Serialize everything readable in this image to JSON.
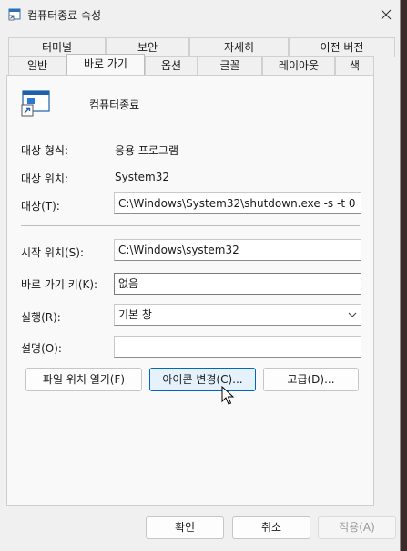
{
  "window": {
    "title": "컴퓨터종료 속성"
  },
  "tabs": {
    "row1": [
      "터미널",
      "보안",
      "자세히",
      "이전 버전"
    ],
    "row2": [
      "일반",
      "바로 가기",
      "옵션",
      "글꼴",
      "레이아웃",
      "색"
    ]
  },
  "shortcut": {
    "name": "컴퓨터종료",
    "target_type_label": "대상 형식:",
    "target_type": "응용 프로그램",
    "target_location_label": "대상 위치:",
    "target_location": "System32",
    "target_label": "대상(T):",
    "target": "C:\\Windows\\System32\\shutdown.exe -s -t 0",
    "start_in_label": "시작 위치(S):",
    "start_in": "C:\\Windows\\system32",
    "hotkey_label": "바로 가기 키(K):",
    "hotkey": "없음",
    "run_label": "실행(R):",
    "run": "기본 창",
    "comment_label": "설명(O):",
    "comment": ""
  },
  "buttons": {
    "open_location": "파일 위치 열기(F)",
    "change_icon": "아이콘 변경(C)...",
    "advanced": "고급(D)..."
  },
  "footer": {
    "ok": "확인",
    "cancel": "취소",
    "apply": "적용(A)"
  },
  "icons": {
    "app": "shortcut-window-icon",
    "close": "close-icon",
    "dropdown": "chevron-down-icon",
    "cursor": "mouse-pointer-icon"
  }
}
